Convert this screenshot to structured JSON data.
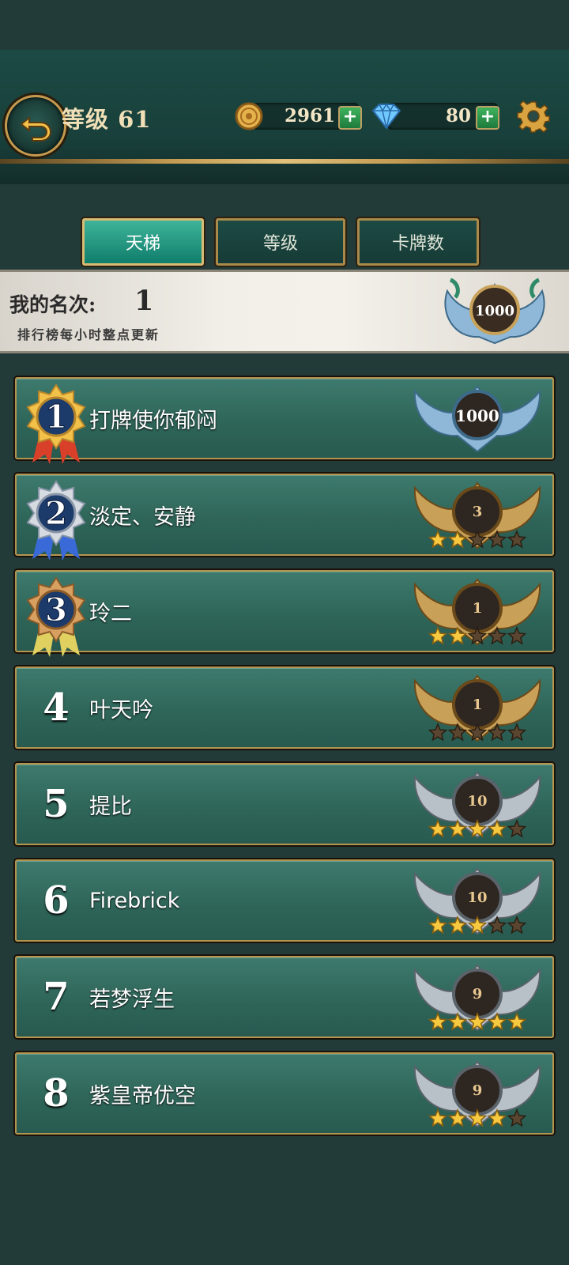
{
  "header": {
    "level_label": "等级 61",
    "coins": "2961",
    "gems": "80",
    "plus_label": "+"
  },
  "tabs": [
    {
      "label": "天梯",
      "active": true
    },
    {
      "label": "等级",
      "active": false
    },
    {
      "label": "卡牌数",
      "active": false
    }
  ],
  "my_rank": {
    "label": "我的名次:",
    "value": "1",
    "note": "排行榜每小时整点更新",
    "badge_value": "1000"
  },
  "colors": {
    "accent_gold": "#c59a4e",
    "active_tab": "#1fa088",
    "row_bg": "#2e6458",
    "coin": "#e3b24a",
    "gem": "#6fc9ff"
  },
  "leaderboard": [
    {
      "rank": "1",
      "name": "打牌使你郁闷",
      "badge": "1000",
      "tier": "legend",
      "stars": 0,
      "medal": "gold"
    },
    {
      "rank": "2",
      "name": "淡定、安静",
      "badge": "3",
      "tier": "gold",
      "stars": 2,
      "medal": "silver"
    },
    {
      "rank": "3",
      "name": "玲二",
      "badge": "1",
      "tier": "gold",
      "stars": 2,
      "medal": "bronze"
    },
    {
      "rank": "4",
      "name": "叶天吟",
      "badge": "1",
      "tier": "gold",
      "stars": 0,
      "medal": ""
    },
    {
      "rank": "5",
      "name": "提比",
      "badge": "10",
      "tier": "silver",
      "stars": 4,
      "medal": ""
    },
    {
      "rank": "6",
      "name": "Firebrick",
      "badge": "10",
      "tier": "silver",
      "stars": 3,
      "medal": ""
    },
    {
      "rank": "7",
      "name": "若梦浮生",
      "badge": "9",
      "tier": "silver",
      "stars": 5,
      "medal": ""
    },
    {
      "rank": "8",
      "name": "紫皇帝优空",
      "badge": "9",
      "tier": "silver",
      "stars": 4,
      "medal": ""
    }
  ]
}
